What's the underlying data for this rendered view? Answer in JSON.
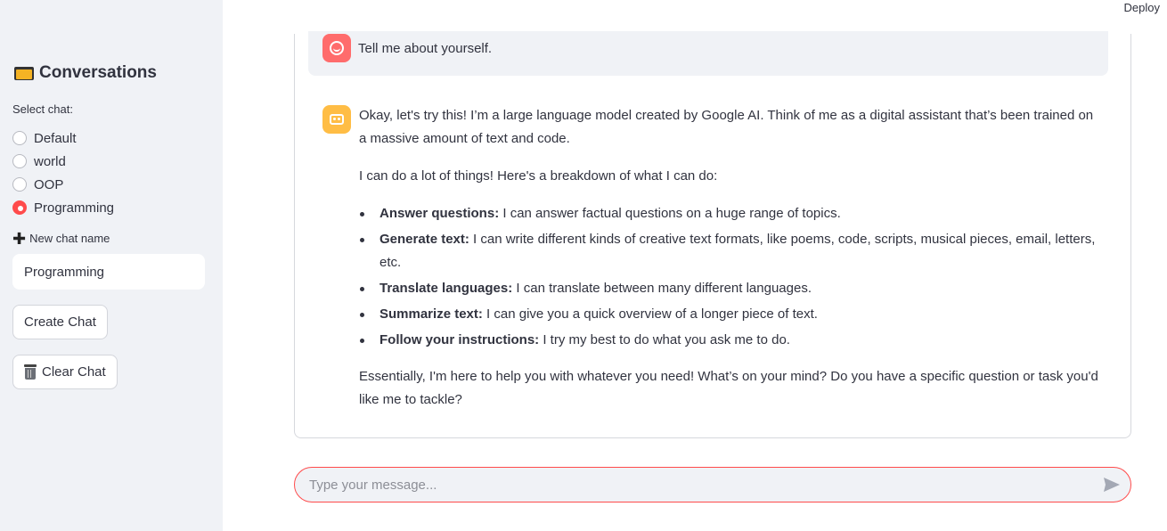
{
  "topbar": {
    "deploy_label": "Deploy"
  },
  "sidebar": {
    "title": "Conversations",
    "select_label": "Select chat:",
    "chats": [
      {
        "label": "Default",
        "selected": false
      },
      {
        "label": "world",
        "selected": false
      },
      {
        "label": "OOP",
        "selected": false
      },
      {
        "label": "Programming",
        "selected": true
      }
    ],
    "new_chat_label": "New chat name",
    "new_chat_value": "Programming",
    "create_button": "Create Chat",
    "clear_button": "Clear Chat"
  },
  "conversation": {
    "user_message": "Tell me about yourself.",
    "assistant": {
      "intro": "Okay, let's try this! I’m a large language model created by Google AI. Think of me as a digital assistant that’s been trained on a massive amount of text and code.",
      "lead": "I can do a lot of things! Here's a breakdown of what I can do:",
      "items": [
        {
          "title": "Answer questions:",
          "text": " I can answer factual questions on a huge range of topics."
        },
        {
          "title": "Generate text:",
          "text": " I can write different kinds of creative text formats, like poems, code, scripts, musical pieces, email, letters, etc."
        },
        {
          "title": "Translate languages:",
          "text": " I can translate between many different languages."
        },
        {
          "title": "Summarize text:",
          "text": " I can give you a quick overview of a longer piece of text."
        },
        {
          "title": "Follow your instructions:",
          "text": " I try my best to do what you ask me to do."
        }
      ],
      "closing": "Essentially, I'm here to help you with whatever you need! What’s on your mind? Do you have a specific question or task you'd like me to tackle?"
    }
  },
  "chat_input": {
    "placeholder": "Type your message...",
    "value": ""
  },
  "colors": {
    "accent": "#ff4b4b",
    "sidebar_bg": "#f0f2f6",
    "user_avatar": "#ff6c6c",
    "assistant_avatar": "#ffbd45"
  },
  "icons": [
    "folder-icon",
    "plus-icon",
    "trash-icon",
    "user-avatar-icon",
    "bot-avatar-icon",
    "send-icon"
  ]
}
